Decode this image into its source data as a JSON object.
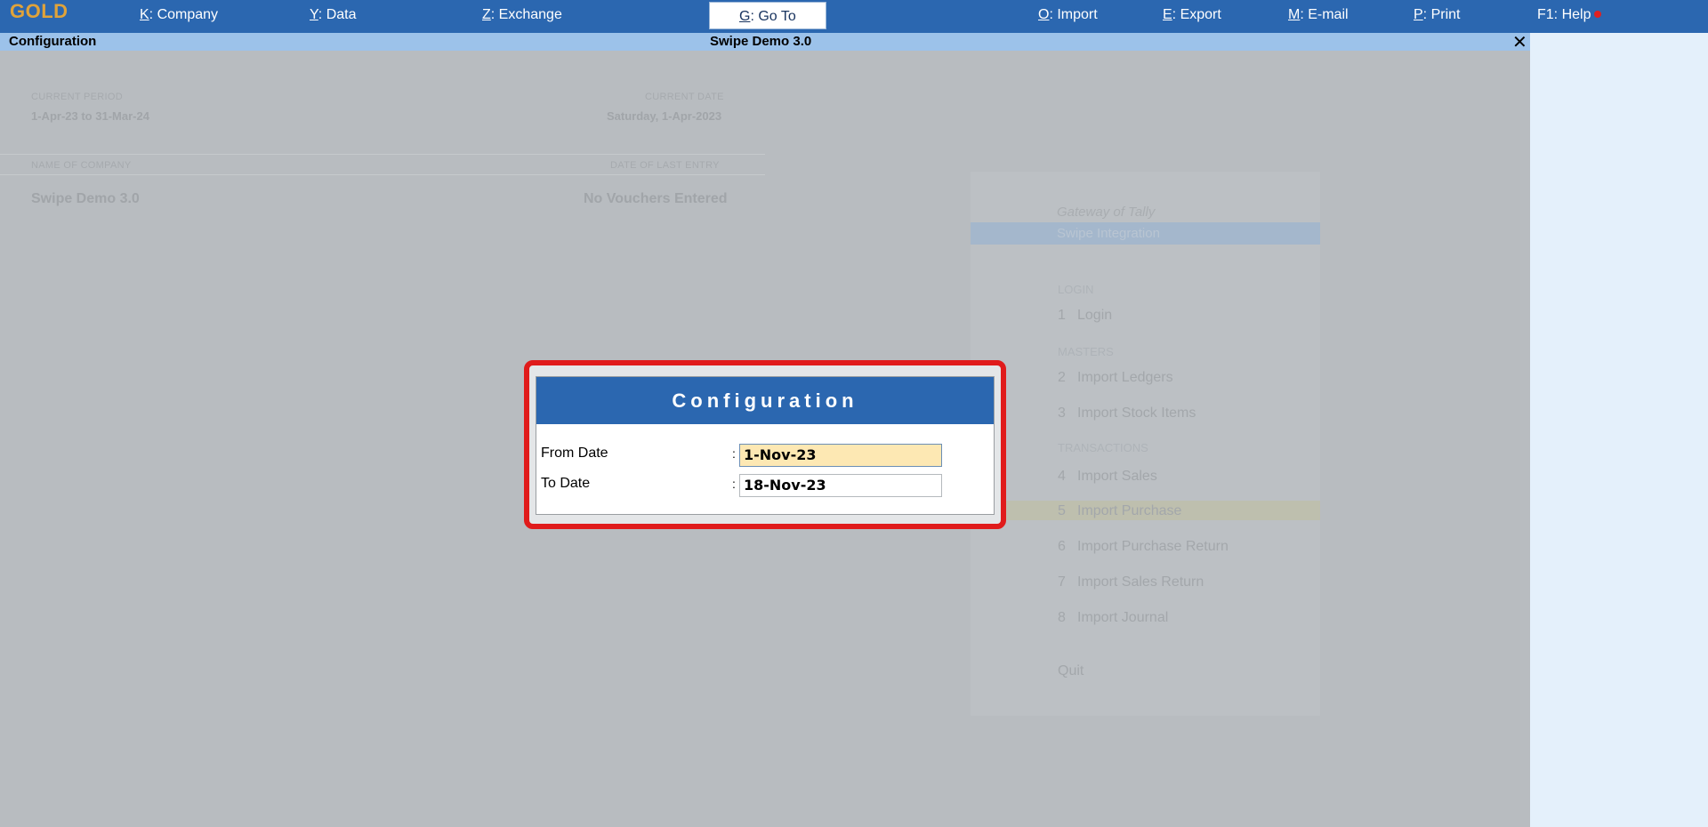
{
  "topbar": {
    "logo": "GOLD",
    "menus": [
      {
        "key": "K",
        "label": ": Company"
      },
      {
        "key": "Y",
        "label": ": Data"
      },
      {
        "key": "Z",
        "label": ": Exchange"
      },
      {
        "key": "G",
        "label": ": Go To"
      },
      {
        "key": "O",
        "label": ": Import"
      },
      {
        "key": "E",
        "label": ": Export"
      },
      {
        "key": "M",
        "label": ": E-mail"
      },
      {
        "key": "P",
        "label": ": Print"
      },
      {
        "key": "",
        "label": "F1: Help"
      }
    ]
  },
  "titlebar": {
    "left": "Configuration",
    "center": "Swipe Demo 3.0",
    "close": "✕"
  },
  "background": {
    "current_period_label": "CURRENT PERIOD",
    "current_period_value": "1-Apr-23 to 31-Mar-24",
    "current_date_label": "CURRENT DATE",
    "current_date_value": "Saturday, 1-Apr-2023",
    "company_label": "NAME OF COMPANY",
    "last_entry_label": "DATE OF LAST ENTRY",
    "company_name": "Swipe Demo 3.0",
    "last_entry_value": "No Vouchers Entered"
  },
  "gateway": {
    "title": "Gateway of Tally",
    "band": "Swipe Integration",
    "sections": {
      "login": "LOGIN",
      "masters": "MASTERS",
      "transactions": "TRANSACTIONS"
    },
    "items": [
      {
        "num": "1",
        "label": "Login"
      },
      {
        "num": "2",
        "label": "Import Ledgers"
      },
      {
        "num": "3",
        "label": "Import Stock Items"
      },
      {
        "num": "4",
        "label": "Import Sales"
      },
      {
        "num": "5",
        "label": "Import Purchase"
      },
      {
        "num": "6",
        "label": "Import Purchase Return"
      },
      {
        "num": "7",
        "label": "Import Sales Return"
      },
      {
        "num": "8",
        "label": "Import Journal"
      }
    ],
    "quit": "Quit"
  },
  "dialog": {
    "title": "Configuration",
    "from_label": "From Date",
    "from_value": "1-Nov-23",
    "to_label": "To Date",
    "to_value": "18-Nov-23",
    "colon": ":"
  }
}
